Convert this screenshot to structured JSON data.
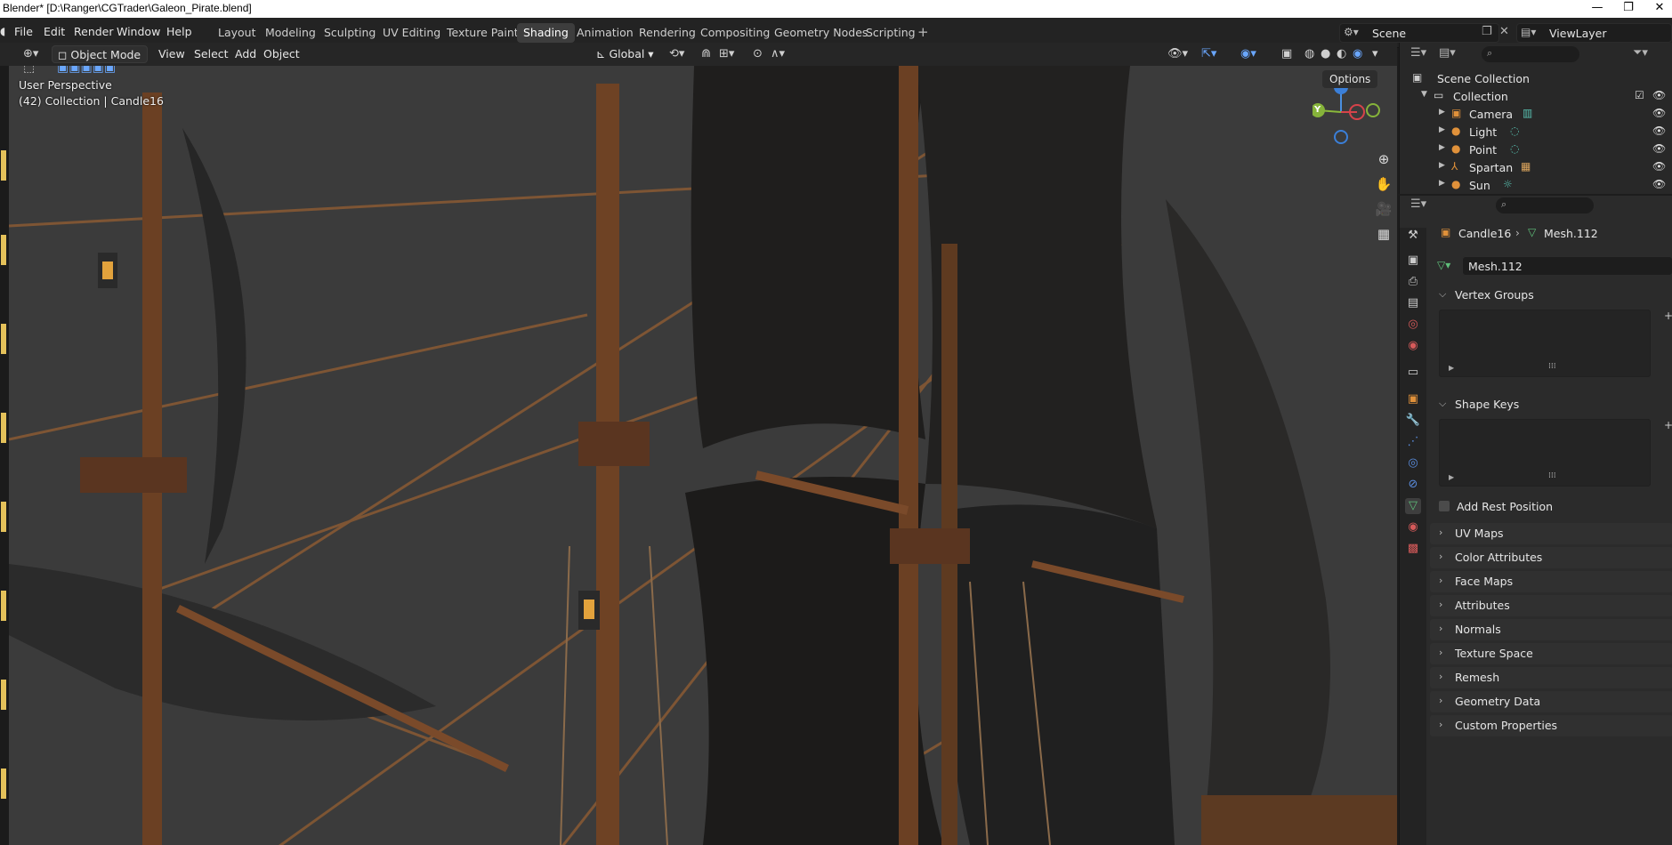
{
  "window": {
    "title": "Blender* [D:\\Ranger\\CGTrader\\Galeon_Pirate.blend]",
    "controls": [
      "—",
      "❐",
      "✕"
    ]
  },
  "menu": [
    "File",
    "Edit",
    "Render",
    "Window",
    "Help"
  ],
  "workspaces": [
    "Layout",
    "Modeling",
    "Sculpting",
    "UV Editing",
    "Texture Paint",
    "Shading",
    "Animation",
    "Rendering",
    "Compositing",
    "Geometry Nodes",
    "Scripting"
  ],
  "active_workspace": "Shading",
  "scene": {
    "name": "Scene",
    "view_layer": "ViewLayer"
  },
  "viewport_header": {
    "mode": "Object Mode",
    "menus": [
      "View",
      "Select",
      "Add",
      "Object"
    ],
    "transform_orientation": "Global"
  },
  "viewport": {
    "perspective_label": "User Perspective",
    "collection_label": "(42) Collection | Candle16",
    "options_label": "Options",
    "gizmo_axes": [
      "Z",
      "Y",
      "X"
    ]
  },
  "outliner": {
    "root": "Scene Collection",
    "collection": "Collection",
    "items": [
      {
        "name": "Camera",
        "icon": "camera-icon"
      },
      {
        "name": "Light",
        "icon": "light-icon"
      },
      {
        "name": "Point",
        "icon": "light-icon"
      },
      {
        "name": "Spartan",
        "icon": "armature-icon"
      },
      {
        "name": "Sun",
        "icon": "light-icon"
      }
    ]
  },
  "properties": {
    "object_name": "Candle16",
    "mesh_name": "Mesh.112",
    "mesh_field": "Mesh.112",
    "panels_open": [
      "Vertex Groups",
      "Shape Keys"
    ],
    "add_rest_position": "Add Rest Position",
    "panels_collapsed": [
      "UV Maps",
      "Color Attributes",
      "Face Maps",
      "Attributes",
      "Normals",
      "Texture Space",
      "Remesh",
      "Geometry Data",
      "Custom Properties"
    ]
  },
  "colors": {
    "accent": "#4772b3",
    "background": "#3b3b3b",
    "panel": "#2b2b2b"
  }
}
